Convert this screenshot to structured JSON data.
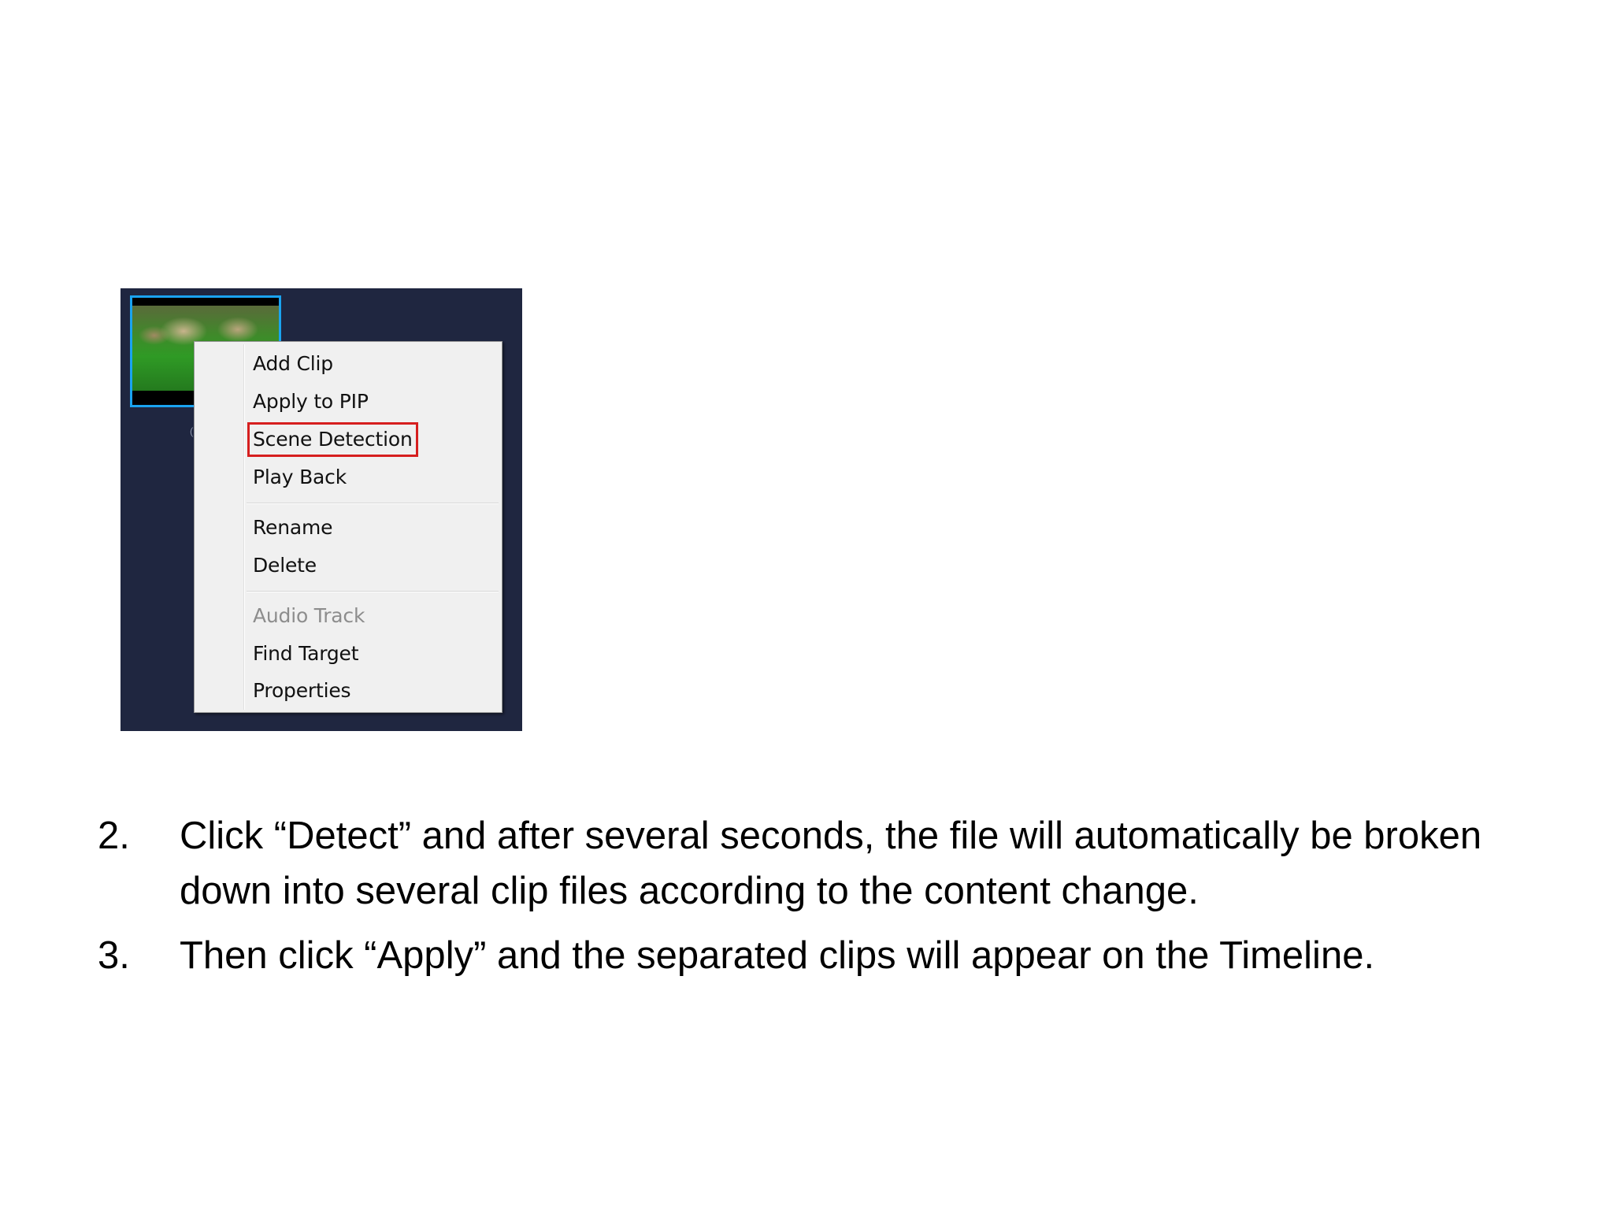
{
  "screenshot": {
    "background_color": "#1f2640",
    "clip": {
      "highlight_color": "#1aa3f0",
      "caption": "("
    },
    "context_menu": {
      "groups": [
        [
          "Add Clip",
          "Apply to PIP",
          "Scene Detection",
          "Play Back"
        ],
        [
          "Rename",
          "Delete"
        ],
        [
          "Audio Track",
          "Find Target",
          "Properties"
        ]
      ],
      "items": {
        "add_clip": "Add Clip",
        "apply_to_pip": "Apply to PIP",
        "scene_detection": "Scene Detection",
        "play_back": "Play Back",
        "rename": "Rename",
        "delete": "Delete",
        "audio_track": "Audio Track",
        "find_target": "Find Target",
        "properties": "Properties"
      },
      "disabled_items": [
        "Audio Track"
      ],
      "highlighted_item": "Scene Detection",
      "highlight_color": "#d61f1f"
    }
  },
  "steps": [
    {
      "number": "2.",
      "text": "Click “Detect” and after several seconds, the file will automatically be broken down into several clip files according to the content change."
    },
    {
      "number": "3.",
      "text": "Then click “Apply” and the separated clips will appear on the Timeline."
    }
  ]
}
